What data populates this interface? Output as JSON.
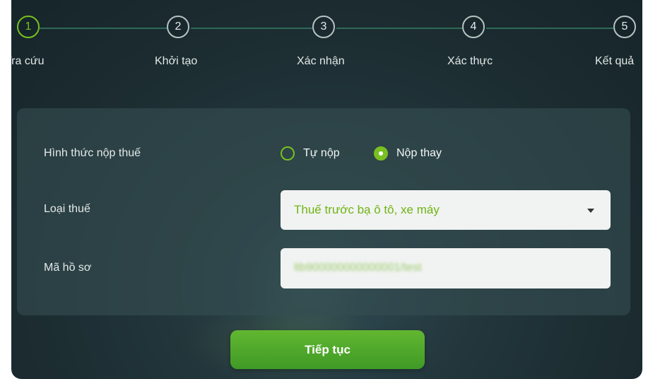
{
  "steps": [
    {
      "number": "1",
      "label": "Tra cứu"
    },
    {
      "number": "2",
      "label": "Khởi tạo"
    },
    {
      "number": "3",
      "label": "Xác nhận"
    },
    {
      "number": "4",
      "label": "Xác thực"
    },
    {
      "number": "5",
      "label": "Kết quả"
    }
  ],
  "active_step": 1,
  "form": {
    "payment_method": {
      "label": "Hình thức nộp thuế",
      "options": [
        "Tự nộp",
        "Nộp thay"
      ],
      "selected": "Nộp thay"
    },
    "tax_type": {
      "label": "Loại thuế",
      "value": "Thuế trước bạ ô tô, xe máy"
    },
    "record_id": {
      "label": "Mã hồ sơ",
      "value": "ltb900000000000001/test"
    }
  },
  "continue_button": "Tiếp tục",
  "colors": {
    "accent": "#78c021",
    "background": "#1e2f34",
    "button": "#4fa82b"
  }
}
